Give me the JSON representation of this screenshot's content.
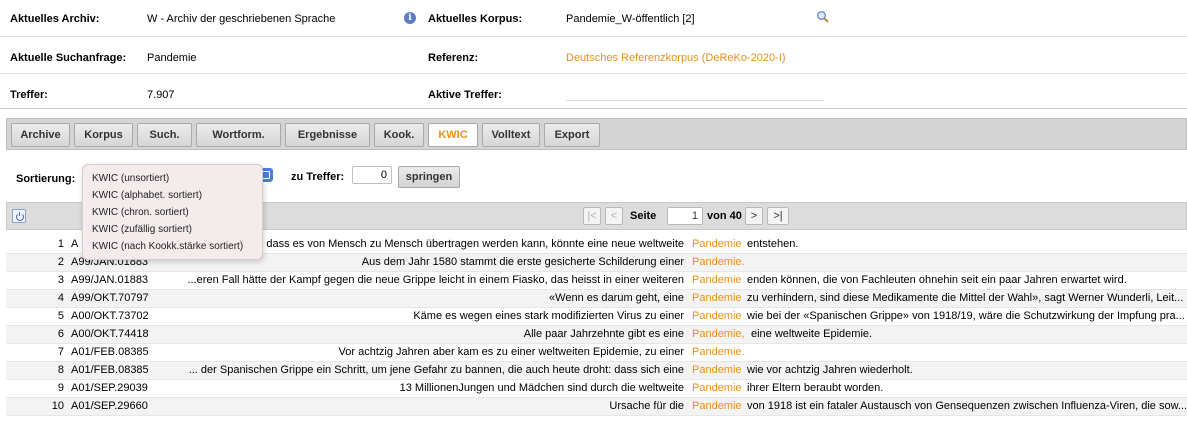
{
  "header": {
    "archiv_label": "Aktuelles Archiv:",
    "archiv_value": "W - Archiv der geschriebenen Sprache",
    "korpus_label": "Aktuelles Korpus:",
    "korpus_value": "Pandemie_W-öffentlich [2]",
    "suchanfrage_label": "Aktuelle Suchanfrage:",
    "suchanfrage_value": "Pandemie",
    "referenz_label": "Referenz:",
    "referenz_value": "Deutsches Referenzkorpus (DeReKo-2020-I)",
    "treffer_label": "Treffer:",
    "treffer_value": "7.907",
    "aktive_treffer_label": "Aktive Treffer:",
    "link_color": "#e8901c"
  },
  "tabs": [
    {
      "label": "Archive"
    },
    {
      "label": "Korpus"
    },
    {
      "label": "Such."
    },
    {
      "label": "Wortform."
    },
    {
      "label": "Ergebnisse"
    },
    {
      "label": "Kook."
    },
    {
      "label": "KWIC",
      "active": true
    },
    {
      "label": "Volltext"
    },
    {
      "label": "Export"
    }
  ],
  "controls": {
    "sortierung_label": "Sortierung:",
    "zu_treffer_label": "zu Treffer:",
    "zu_treffer_value": "0",
    "springen_label": "springen"
  },
  "dropdown": {
    "options": [
      "KWIC (unsortiert)",
      "KWIC (alphabet. sortiert)",
      "KWIC (chron. sortiert)",
      "KWIC (zufällig sortiert)",
      "KWIC (nach Kookk.stärke sortiert)"
    ]
  },
  "pager": {
    "first": "|<",
    "prev": "<",
    "seite_label": "Seite",
    "page": "1",
    "von_label": "von 40",
    "next": ">",
    "last": ">|"
  },
  "rows": [
    {
      "n": "1",
      "sig": "A",
      "left": "dass es von Mensch zu Mensch übertragen werden kann, könnte eine neue weltweite",
      "kw": "Pandemie",
      "right": "entstehen."
    },
    {
      "n": "2",
      "sig": "A99/JAN.01883",
      "left": "Aus dem Jahr 1580 stammt die erste gesicherte Schilderung einer",
      "kw": "Pandemie.",
      "right": ""
    },
    {
      "n": "3",
      "sig": "A99/JAN.01883",
      "left": "...eren Fall hätte der Kampf gegen die neue Grippe leicht in einem Fiasko, das heisst in einer weiteren",
      "kw": "Pandemie",
      "right": "enden können, die von Fachleuten ohnehin seit ein paar Jahren erwartet wird."
    },
    {
      "n": "4",
      "sig": "A99/OKT.70797",
      "left": "«Wenn es darum geht, eine",
      "kw": "Pandemie",
      "right": "zu verhindern, sind diese Medikamente die Mittel der Wahl», sagt Werner Wunderli, Leit..."
    },
    {
      "n": "5",
      "sig": "A00/OKT.73702",
      "left": "Käme es wegen eines stark modifizierten Virus zu einer",
      "kw": "Pandemie",
      "right": "wie bei der «Spanischen Grippe» von 1918/19, wäre die Schutzwirkung der Impfung pra..."
    },
    {
      "n": "6",
      "sig": "A00/OKT.74418",
      "left": "Alle paar Jahrzehnte gibt es eine",
      "kw": "Pandemie,",
      "right": "eine weltweite Epidemie."
    },
    {
      "n": "7",
      "sig": "A01/FEB.08385",
      "left": "Vor achtzig Jahren aber kam es zu einer weltweiten Epidemie, zu einer",
      "kw": "Pandemie.",
      "right": ""
    },
    {
      "n": "8",
      "sig": "A01/FEB.08385",
      "left": "... der Spanischen Grippe ein Schritt, um jene Gefahr zu bannen, die auch heute droht: dass sich eine",
      "kw": "Pandemie",
      "right": "wie vor achtzig Jahren wiederholt."
    },
    {
      "n": "9",
      "sig": "A01/SEP.29039",
      "left": "13 MillionenJungen und Mädchen sind durch die weltweite",
      "kw": "Pandemie",
      "right": "ihrer Eltern beraubt worden."
    },
    {
      "n": "10",
      "sig": "A01/SEP.29660",
      "left": "Ursache für die",
      "kw": "Pandemie",
      "right": "von 1918 ist ein fataler Austausch von Gensequenzen zwischen Influenza-Viren, die sow..."
    }
  ]
}
